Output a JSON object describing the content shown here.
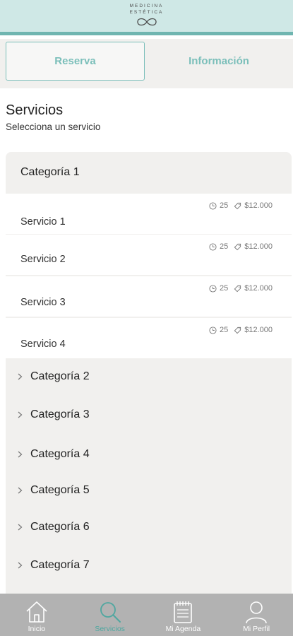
{
  "header": {
    "logo_line1": "MEDICINA",
    "logo_line2": "ESTÉTICA"
  },
  "tabs": [
    {
      "label": "Reserva",
      "active": true
    },
    {
      "label": "Información",
      "active": false
    }
  ],
  "section": {
    "title": "Servicios",
    "subtitle": "Selecciona un servicio"
  },
  "open_category": {
    "label": "Categoría 1",
    "services": [
      {
        "name": "Servicio 1",
        "duration": "25",
        "price": "$12.000"
      },
      {
        "name": "Servicio 2",
        "duration": "25",
        "price": "$12.000"
      },
      {
        "name": "Servicio 3",
        "duration": "25",
        "price": "$12.000"
      },
      {
        "name": "Servicio 4",
        "duration": "25",
        "price": "$12.000"
      }
    ]
  },
  "categories": [
    {
      "label": "Categoría 2"
    },
    {
      "label": "Categoría 3"
    },
    {
      "label": "Categoría 4"
    },
    {
      "label": "Categoría 5"
    },
    {
      "label": "Categoría 6"
    },
    {
      "label": "Categoría 7"
    }
  ],
  "nav": [
    {
      "label": "Inicio",
      "icon": "home-icon"
    },
    {
      "label": "Servicios",
      "icon": "search-icon",
      "active": true
    },
    {
      "label": "Mi Agenda",
      "icon": "calendar-icon"
    },
    {
      "label": "Mi Perfil",
      "icon": "user-icon"
    }
  ],
  "colors": {
    "accent": "#7bbfba",
    "header_bg": "#cfe8e6",
    "nav_bg": "#b2b2b2",
    "nav_active": "#4fa7a0"
  }
}
